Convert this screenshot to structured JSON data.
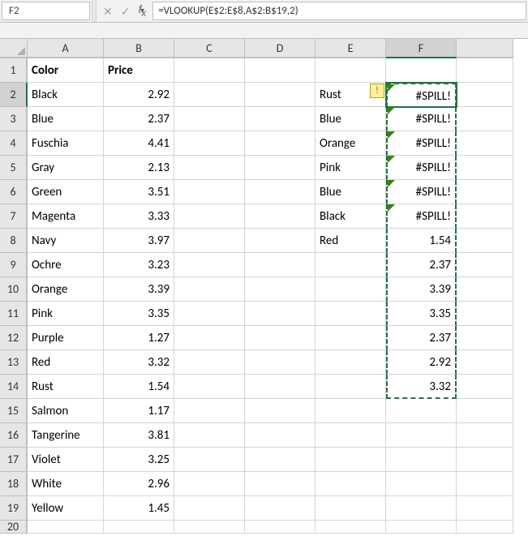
{
  "name_box": "F2",
  "formula": "=VLOOKUP(E$2:E$8,A$2:B$19,2)",
  "columns": [
    "A",
    "B",
    "C",
    "D",
    "E",
    "F",
    ""
  ],
  "headers": {
    "A1": "Color",
    "B1": "Price"
  },
  "table": [
    {
      "color": "Black",
      "price": "2.92"
    },
    {
      "color": "Blue",
      "price": "2.37"
    },
    {
      "color": "Fuschia",
      "price": "4.41"
    },
    {
      "color": "Gray",
      "price": "2.13"
    },
    {
      "color": "Green",
      "price": "3.51"
    },
    {
      "color": "Magenta",
      "price": "3.33"
    },
    {
      "color": "Navy",
      "price": "3.97"
    },
    {
      "color": "Ochre",
      "price": "3.23"
    },
    {
      "color": "Orange",
      "price": "3.39"
    },
    {
      "color": "Pink",
      "price": "3.35"
    },
    {
      "color": "Purple",
      "price": "1.27"
    },
    {
      "color": "Red",
      "price": "3.32"
    },
    {
      "color": "Rust",
      "price": "1.54"
    },
    {
      "color": "Salmon",
      "price": "1.17"
    },
    {
      "color": "Tangerine",
      "price": "3.81"
    },
    {
      "color": "Violet",
      "price": "3.25"
    },
    {
      "color": "White",
      "price": "2.96"
    },
    {
      "color": "Yellow",
      "price": "1.45"
    }
  ],
  "lookup_col": [
    "Rust",
    "Blue",
    "Orange",
    "Pink",
    "Blue",
    "Black",
    "Red"
  ],
  "result_col": [
    "#SPILL!",
    "#SPILL!",
    "#SPILL!",
    "#SPILL!",
    "#SPILL!",
    "#SPILL!",
    "1.54",
    "2.37",
    "3.39",
    "3.35",
    "2.37",
    "2.92",
    "3.32"
  ],
  "warn_glyph": "!",
  "chart_data": {
    "type": "table",
    "headers": [
      "Color",
      "Price"
    ],
    "rows": [
      [
        "Black",
        2.92
      ],
      [
        "Blue",
        2.37
      ],
      [
        "Fuschia",
        4.41
      ],
      [
        "Gray",
        2.13
      ],
      [
        "Green",
        3.51
      ],
      [
        "Magenta",
        3.33
      ],
      [
        "Navy",
        3.97
      ],
      [
        "Ochre",
        3.23
      ],
      [
        "Orange",
        3.39
      ],
      [
        "Pink",
        3.35
      ],
      [
        "Purple",
        1.27
      ],
      [
        "Red",
        3.32
      ],
      [
        "Rust",
        1.54
      ],
      [
        "Salmon",
        1.17
      ],
      [
        "Tangerine",
        3.81
      ],
      [
        "Violet",
        3.25
      ],
      [
        "White",
        2.96
      ],
      [
        "Yellow",
        1.45
      ]
    ],
    "lookup_input": [
      "Rust",
      "Blue",
      "Orange",
      "Pink",
      "Blue",
      "Black",
      "Red"
    ],
    "lookup_output": [
      "#SPILL!",
      "#SPILL!",
      "#SPILL!",
      "#SPILL!",
      "#SPILL!",
      "#SPILL!",
      1.54,
      2.37,
      3.39,
      3.35,
      2.37,
      2.92,
      3.32
    ]
  }
}
